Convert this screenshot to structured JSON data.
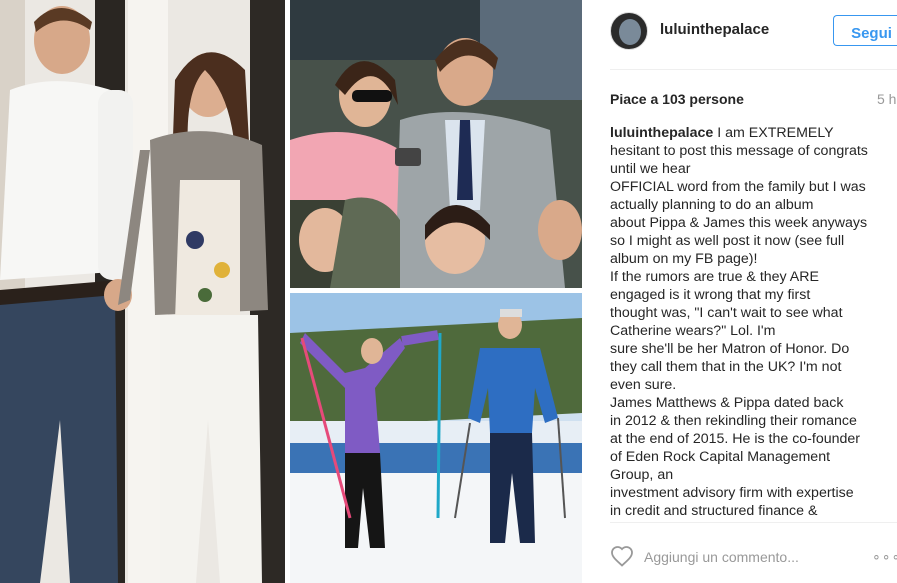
{
  "post": {
    "username": "luluinthepalace",
    "follow_label": "Segui",
    "likes_text": "Piace a 103 persone",
    "time_ago": "5 h",
    "caption_lines": [
      "I am EXTREMELY",
      "hesitant to post this message of congrats",
      "until we hear",
      "OFFICIAL word from the family but I was",
      "actually planning to do an album",
      "about Pippa & James this week anyways",
      "so I might as well post it now (see full",
      "album on my FB page)!",
      "If the rumors are true & they ARE",
      "engaged is it wrong that my first",
      "thought was, \"I can't wait to see what",
      "Catherine wears?\" Lol. I'm",
      "sure she'll be her Matron of Honor. Do",
      "they call them that in the UK? I'm not",
      "even sure.",
      "James Matthews & Pippa dated back",
      "in 2012 & then rekindling their romance",
      "at the end of 2015. He is the co-founder",
      "of Eden Rock Capital Management",
      "Group, an",
      "investment advisory firm with expertise",
      "in credit and structured finance &"
    ],
    "comment_placeholder": "Aggiungi un commento...",
    "more_label": "∘∘∘"
  },
  "icons": {
    "heart": "heart-icon",
    "more": "more-options-icon",
    "avatar": "avatar"
  },
  "colors": {
    "accent": "#3897f0",
    "text": "#262626",
    "muted": "#999999",
    "divider": "#efefef"
  }
}
